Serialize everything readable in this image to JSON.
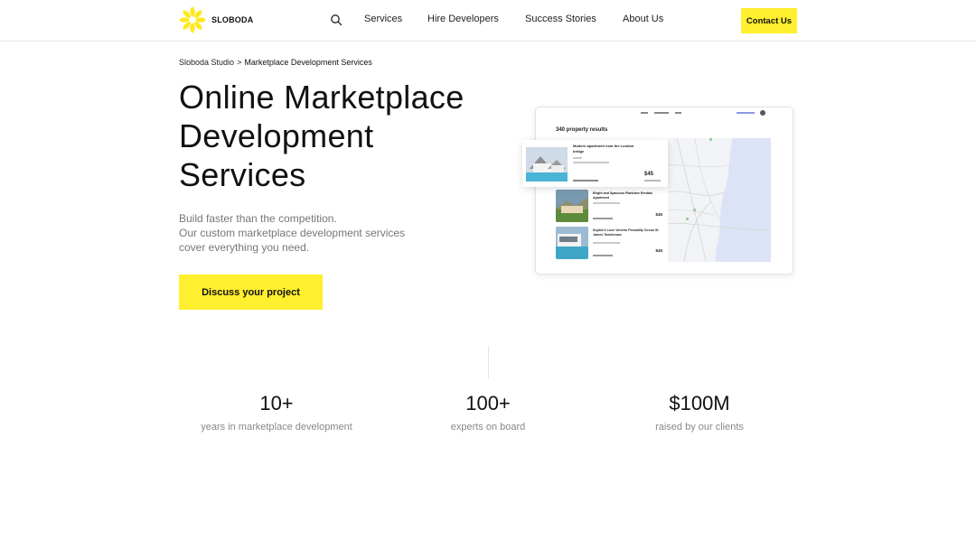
{
  "header": {
    "logo_text": "SLOBODA",
    "logo_color": "#ffe81f",
    "nav": [
      "Services",
      "Hire Developers",
      "Success Stories",
      "About Us"
    ],
    "contact_label": "Contact Us"
  },
  "breadcrumb": {
    "root": "Sloboda Studio",
    "separator": ">",
    "current": "Marketplace Development Services"
  },
  "hero": {
    "title_lines": [
      "Online Marketplace",
      "Development",
      "Services"
    ],
    "subtitle_lines": [
      "Build faster than the competition.",
      "Our custom marketplace development services",
      "cover everything you need."
    ],
    "cta_label": "Discuss your project",
    "accent_color": "#ffef2e"
  },
  "mockup": {
    "results": "340 property results",
    "listings": [
      {
        "title": "Modern apartment near the London bridge",
        "price": "$45"
      },
      {
        "title": "Bright and Spacious Flatshare Rentals Apartment",
        "price": "$45"
      },
      {
        "title": "Sophie's Luxe Venerio Piccadilly Circus St James Townhouse",
        "price": "$45"
      }
    ]
  },
  "stats": [
    {
      "value": "10+",
      "label": "years in marketplace development"
    },
    {
      "value": "100+",
      "label": "experts on board"
    },
    {
      "value": "$100M",
      "label": "raised by our clients"
    }
  ]
}
